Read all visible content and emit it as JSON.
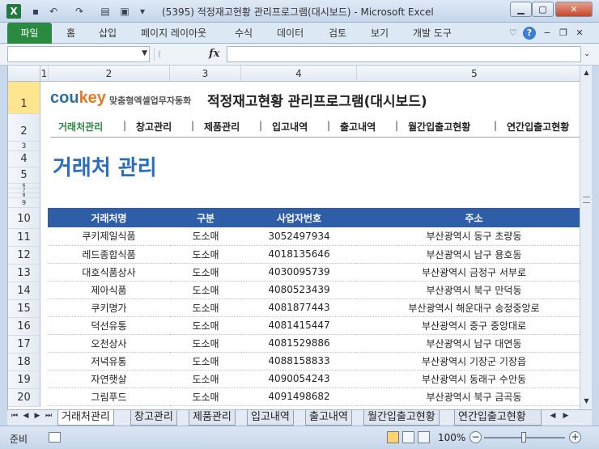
{
  "window": {
    "title": "(5395) 적정재고현황 관리프로그램(대시보드) - Microsoft Excel",
    "app_icon": "X"
  },
  "ribbon_tabs": [
    "파일",
    "홈",
    "삽입",
    "페이지 레이아웃",
    "수식",
    "데이터",
    "검토",
    "보기",
    "개발 도구"
  ],
  "formula_bar": {
    "name_box": "",
    "formula": "",
    "fx_label": "fx"
  },
  "columns": [
    "1",
    "2",
    "3",
    "4",
    "5"
  ],
  "rows": [
    "1",
    "2",
    "3",
    "4",
    "5",
    "6",
    "7",
    "8",
    "9",
    "10",
    "11",
    "12",
    "13",
    "14",
    "15",
    "16",
    "17",
    "18",
    "19",
    "20"
  ],
  "header": {
    "logo_main": "cou",
    "logo_accent": "key",
    "logo_sub": "맞춤형엑셀업무자동화",
    "title": "적정재고현황 관리프로그램(대시보드)"
  },
  "nav": {
    "items": [
      "거래처관리",
      "창고관리",
      "제품관리",
      "입고내역",
      "출고내역",
      "월간입출고현황",
      "연간입출고현황"
    ],
    "separator": "|",
    "active_index": 0
  },
  "section_title": "거래처 관리",
  "table": {
    "headers": [
      "거래처명",
      "구분",
      "사업자번호",
      "주소"
    ],
    "rows": [
      [
        "쿠키제일식품",
        "도소매",
        "3052497934",
        "부산광역시 동구 초량동"
      ],
      [
        "레드종합식품",
        "도소매",
        "4018135646",
        "부산광역시 남구 용호동"
      ],
      [
        "대호식품상사",
        "도소매",
        "4030095739",
        "부산광역시 금정구 서부로"
      ],
      [
        "제아식품",
        "도소매",
        "4080523439",
        "부산광역시 북구 만덕동"
      ],
      [
        "쿠키명가",
        "도소매",
        "4081877443",
        "부산광역시 해운대구 송정중앙로"
      ],
      [
        "덕선유통",
        "도소매",
        "4081415447",
        "부산광역시 중구 중앙대로"
      ],
      [
        "오천상사",
        "도소매",
        "4081529886",
        "부산광역시 남구 대연동"
      ],
      [
        "저녁유통",
        "도소매",
        "4088158833",
        "부산광역시 기장군 기장읍"
      ],
      [
        "자연햇살",
        "도소매",
        "4090054243",
        "부산광역시 동래구 수안동"
      ],
      [
        "그림푸드",
        "도소매",
        "4091498682",
        "부산광역시 북구 금곡동"
      ]
    ]
  },
  "sheet_tabs": [
    "거래처관리",
    "창고관리",
    "제품관리",
    "입고내역",
    "출고내역",
    "월간입출고현황",
    "연간입출고현황"
  ],
  "status": {
    "ready": "준비",
    "zoom": "100%"
  },
  "colors": {
    "accent_green": "#2a8a3f",
    "table_header": "#2e5ea8",
    "section_title": "#2a6ec0"
  }
}
